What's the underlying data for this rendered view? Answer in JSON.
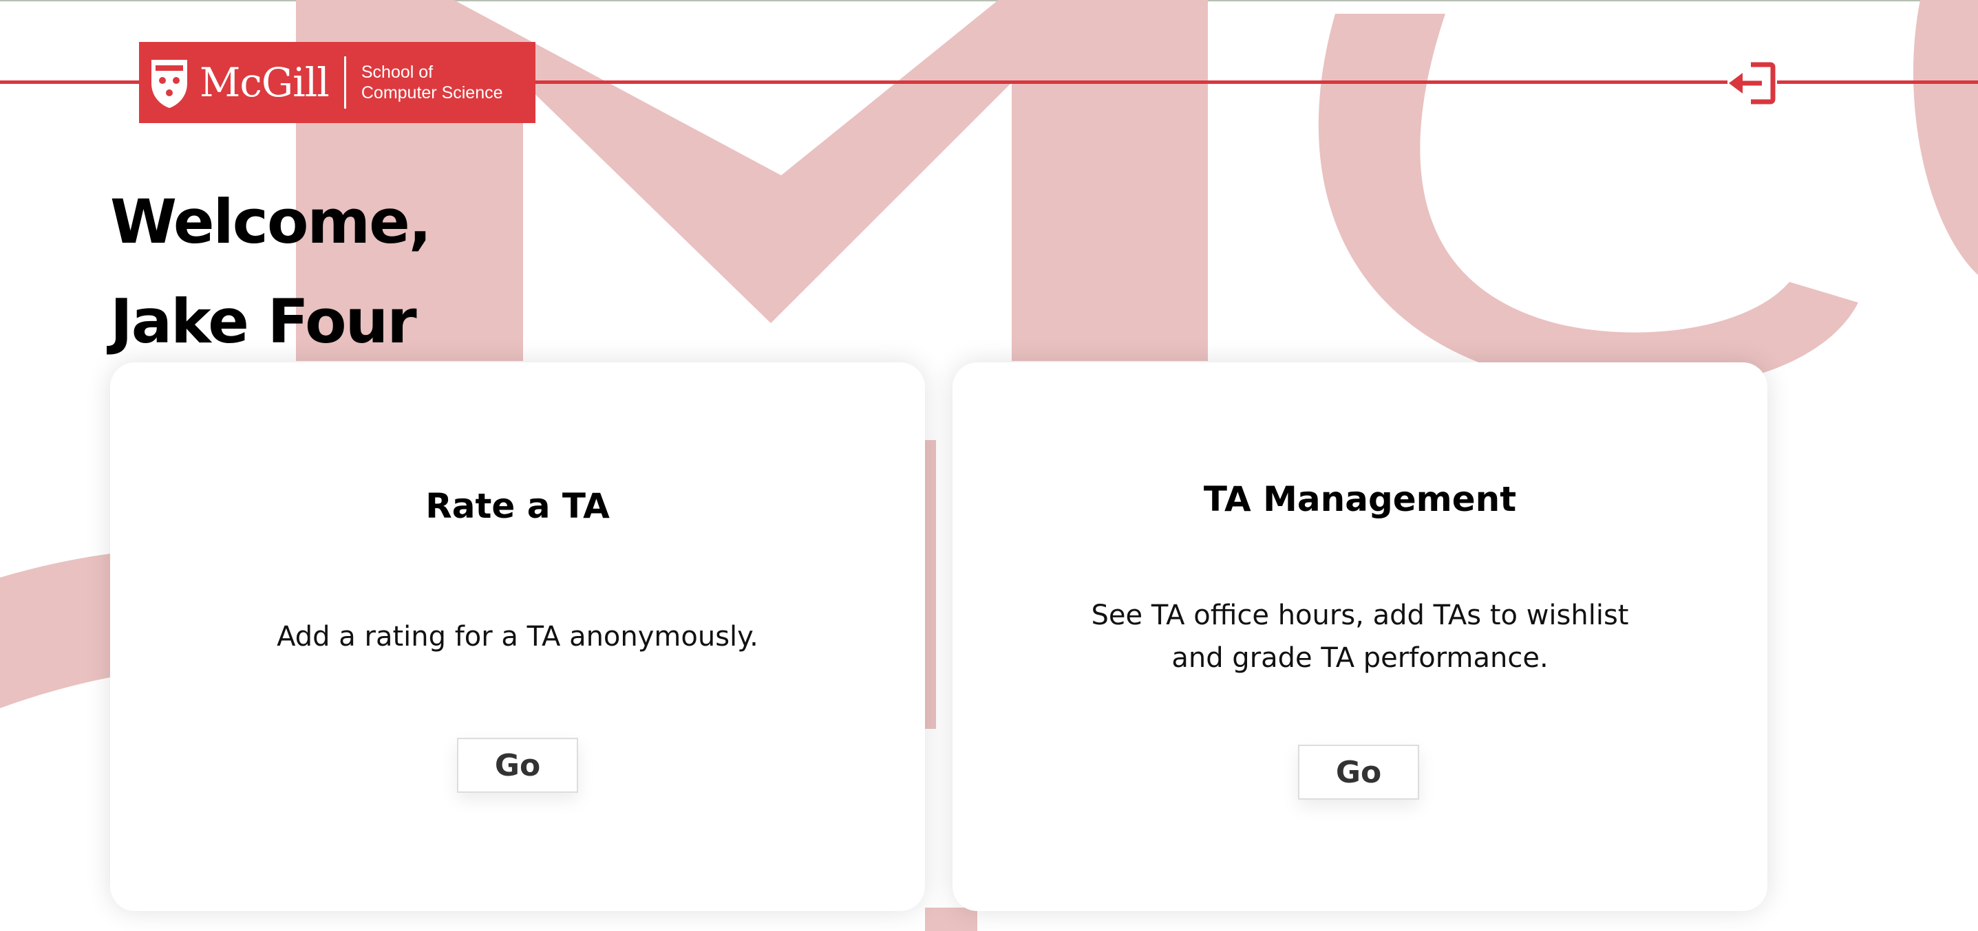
{
  "header": {
    "logo_wordmark": "McGill",
    "logo_dept_line1": "School of",
    "logo_dept_line2": "Computer Science",
    "logout_icon": "logout-icon",
    "brand_color": "#d9363e"
  },
  "welcome": {
    "line1": "Welcome,",
    "line2": "Jake Four"
  },
  "cards": [
    {
      "title": "Rate a TA",
      "description_lines": [
        "Add a rating for a TA anonymously."
      ],
      "button_label": "Go"
    },
    {
      "title": "TA Management",
      "description_lines": [
        "See TA office hours, add TAs to wishlist",
        "and grade TA performance."
      ],
      "button_label": "Go"
    }
  ]
}
